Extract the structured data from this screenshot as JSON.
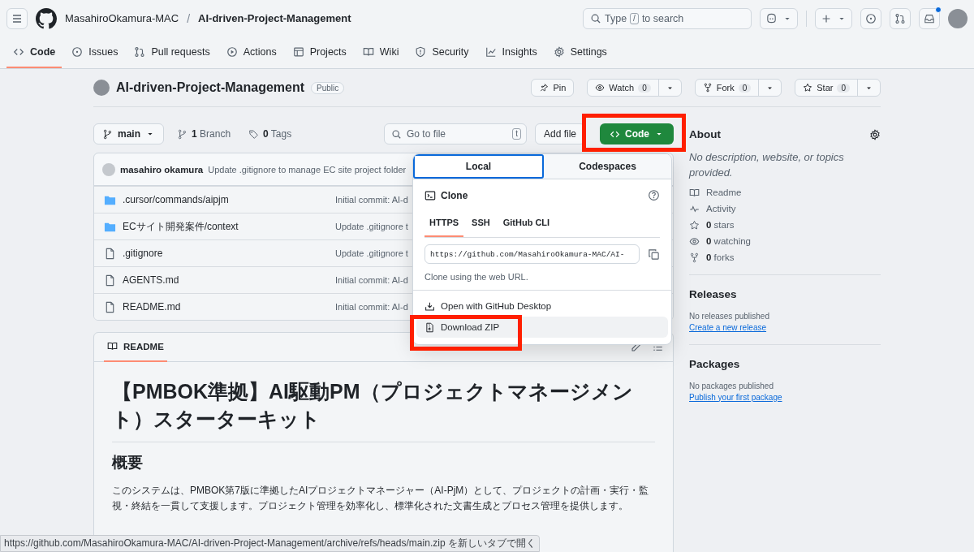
{
  "header": {
    "owner": "MasahiroOkamura-MAC",
    "separator": "/",
    "repo": "AI-driven-Project-Management",
    "search": {
      "before": "Type",
      "key": "/",
      "after": "to search"
    },
    "notification": true
  },
  "nav": [
    {
      "label": "Code",
      "selected": true
    },
    {
      "label": "Issues",
      "selected": false
    },
    {
      "label": "Pull requests",
      "selected": false
    },
    {
      "label": "Actions",
      "selected": false
    },
    {
      "label": "Projects",
      "selected": false
    },
    {
      "label": "Wiki",
      "selected": false
    },
    {
      "label": "Security",
      "selected": false
    },
    {
      "label": "Insights",
      "selected": false
    },
    {
      "label": "Settings",
      "selected": false
    }
  ],
  "repo": {
    "name": "AI-driven-Project-Management",
    "visibility": "Public",
    "actions": [
      {
        "label": "Pin"
      },
      {
        "label": "Watch",
        "count": "0"
      },
      {
        "label": "Fork",
        "count": "0"
      },
      {
        "label": "Star",
        "count": "0"
      }
    ]
  },
  "toolbar": {
    "branch": "main",
    "branches": "**1** Branch",
    "tags": "**0** Tags",
    "file_search": {
      "placeholder": "Go to file",
      "key": "t"
    },
    "add_file": "Add file",
    "code_button": "Code"
  },
  "commit": {
    "author": "masahiro okamura",
    "message": "Update .gitignore to manage EC site project folder"
  },
  "files": [
    {
      "kind": "folder",
      "name": ".cursor/commands/aipjm",
      "commit": "Initial commit: AI-d"
    },
    {
      "kind": "folder",
      "name": "ECサイト開発案件/context",
      "commit": "Update .gitignore t"
    },
    {
      "kind": "file",
      "name": ".gitignore",
      "commit": "Update .gitignore t"
    },
    {
      "kind": "file",
      "name": "AGENTS.md",
      "commit": "Initial commit: AI-d"
    },
    {
      "kind": "file",
      "name": "README.md",
      "commit": "Initial commit: AI-d"
    }
  ],
  "code_menu": {
    "tabs": [
      {
        "label": "Local",
        "selected": true
      },
      {
        "label": "Codespaces",
        "selected": false
      }
    ],
    "title": "Clone",
    "protocols": [
      {
        "label": "HTTPS",
        "selected": true
      },
      {
        "label": "SSH",
        "selected": false
      },
      {
        "label": "GitHub CLI",
        "selected": false
      }
    ],
    "url": "https://github.com/MasahiroOkamura-MAC/AI-",
    "hint": "Clone using the web URL.",
    "actions": [
      {
        "kind": "desktop",
        "label": "Open with GitHub Desktop",
        "highlighted": false
      },
      {
        "kind": "zip",
        "label": "Download ZIP",
        "highlighted": true
      }
    ]
  },
  "readme": {
    "tab": "README",
    "title": "【PMBOK準拠】AI駆動PM（プロジェクトマネージメント）スターターキット",
    "heading": "概要",
    "paragraph": "このシステムは、PMBOK第7版に準拠したAIプロジェクトマネージャー（AI-PjM）として、プロジェクトの計画・実行・監視・終結を一貫して支援します。プロジェクト管理を効率化し、標準化された文書生成とプロセス管理を提供します。"
  },
  "sidebar": {
    "about": {
      "title": "About",
      "description": "No description, website, or topics provided.",
      "items": [
        {
          "kind": "readme",
          "text": "Readme"
        },
        {
          "kind": "activity",
          "text": "Activity"
        },
        {
          "kind": "stars",
          "text": "**0** stars"
        },
        {
          "kind": "watchers",
          "text": "**0** watching"
        },
        {
          "kind": "forks",
          "text": "**0** forks"
        }
      ]
    },
    "releases": {
      "title": "Releases",
      "note": "No releases published",
      "link": "Create a new release"
    },
    "packages": {
      "title": "Packages",
      "note": "No packages published",
      "link": "Publish your first package"
    }
  },
  "status_bar": "https://github.com/MasahiroOkamura-MAC/AI-driven-Project-Management/archive/refs/heads/main.zip を新しいタブで開く"
}
